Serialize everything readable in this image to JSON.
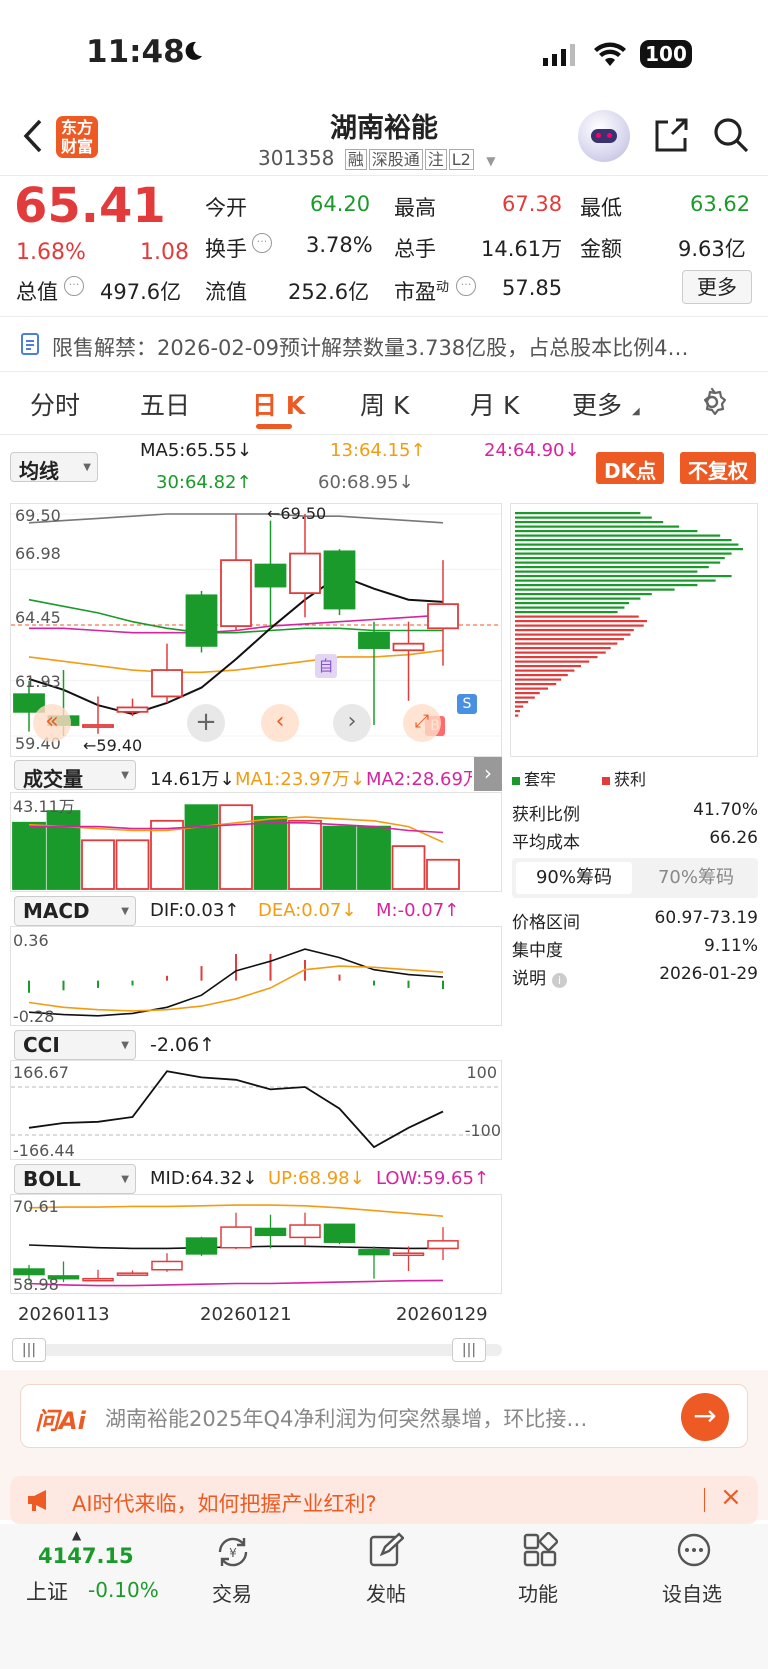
{
  "status_bar": {
    "time": "11:48",
    "battery": "100"
  },
  "header": {
    "logo": "东方财富",
    "title": "湖南裕能",
    "code": "301358",
    "tags": [
      "融",
      "深股通",
      "注",
      "L2"
    ]
  },
  "quote": {
    "price": "65.41",
    "change_pct": "1.68%",
    "change": "1.08",
    "open_label": "今开",
    "open": "64.20",
    "high_label": "最高",
    "high": "67.38",
    "low_label": "最低",
    "low": "63.62",
    "turnover_label": "换手",
    "turnover": "3.78%",
    "volume_label": "总手",
    "volume": "14.61万",
    "amount_label": "金额",
    "amount": "9.63亿",
    "mktcap_label": "总值",
    "mktcap": "497.6亿",
    "float_label": "流值",
    "float": "252.6亿",
    "pe_label": "市盈",
    "pe_sup": "动",
    "pe": "57.85",
    "more_button": "更多"
  },
  "notice": "限售解禁：2026-02-09预计解禁数量3.738亿股，占总股本比例4…",
  "tabs": [
    "分时",
    "五日",
    "日 K",
    "周 K",
    "月 K",
    "更多"
  ],
  "active_tab": 2,
  "ma_bar": {
    "select": "均线",
    "ma5": "MA5:65.55",
    "ma13": "13:64.15",
    "ma24": "24:64.90",
    "ma30": "30:64.82",
    "ma60": "60:68.95",
    "dk_button": "DK点",
    "fq_button": "不复权"
  },
  "kchart": {
    "ymax": "69.50",
    "y2": "66.98",
    "y3": "64.45",
    "y4": "61.93",
    "ymin": "59.40",
    "hi_mark": "69.50",
    "lo_mark": "59.40",
    "self_mark": "自",
    "s_mark": "S",
    "b_mark": "B"
  },
  "chips": {
    "legend_locked": "套牢",
    "legend_profit": "获利",
    "profit_ratio_label": "获利比例",
    "profit_ratio": "41.70%",
    "avg_cost_label": "平均成本",
    "avg_cost": "66.26",
    "tab_90": "90%筹码",
    "tab_70": "70%筹码",
    "range_label": "价格区间",
    "range": "60.97-73.19",
    "concentration_label": "集中度",
    "concentration": "9.11%",
    "note_label": "说明",
    "note": "2026-01-29"
  },
  "volume": {
    "select": "成交量",
    "value": "14.61万",
    "ma1": "MA1:23.97万",
    "ma2": "MA2:28.69万",
    "ymax": "43.11万"
  },
  "macd": {
    "select": "MACD",
    "dif": "DIF:0.03",
    "dea": "DEA:0.07",
    "m": "M:-0.07",
    "ymax": "0.36",
    "ymin": "-0.28"
  },
  "cci": {
    "select": "CCI",
    "value": "-2.06",
    "ymax": "166.67",
    "ymin": "-166.44",
    "r100": "100",
    "rm100": "-100"
  },
  "boll": {
    "select": "BOLL",
    "mid": "MID:64.32",
    "up": "UP:68.98",
    "low": "LOW:59.65",
    "ymax": "70.61",
    "ymin": "58.98"
  },
  "dates": [
    "20260113",
    "20260121",
    "20260129"
  ],
  "ai": {
    "placeholder": "湖南裕能2025年Q4净利润为何突然暴增，环比接…",
    "logo": "问Ai"
  },
  "banner": "AI时代来临，如何把握产业红利?",
  "nav": {
    "index_value": "4147.15",
    "index_name": "上证",
    "index_change": "-0.10%",
    "items": [
      "交易",
      "发帖",
      "功能",
      "设自选"
    ]
  },
  "colors": {
    "up": "#e23b3b",
    "down": "#1a9a2a",
    "accent": "#ee5a24"
  },
  "chart_data": {
    "type": "candlestick",
    "candles": [
      {
        "open": 61.3,
        "close": 60.5,
        "high": 61.9,
        "low": 59.6
      },
      {
        "open": 60.3,
        "close": 59.9,
        "high": 62.4,
        "low": 59.4
      },
      {
        "open": 59.9,
        "close": 59.9,
        "high": 61.2,
        "low": 59.5
      },
      {
        "open": 60.5,
        "close": 60.7,
        "high": 61.1,
        "low": 60.3
      },
      {
        "open": 61.2,
        "close": 62.4,
        "high": 63.6,
        "low": 60.9
      },
      {
        "open": 65.8,
        "close": 63.5,
        "high": 66.0,
        "low": 63.2
      },
      {
        "open": 64.4,
        "close": 67.4,
        "high": 69.5,
        "low": 64.2
      },
      {
        "open": 67.2,
        "close": 66.2,
        "high": 69.2,
        "low": 64.3
      },
      {
        "open": 65.9,
        "close": 67.7,
        "high": 69.5,
        "low": 64.8
      },
      {
        "open": 67.8,
        "close": 65.2,
        "high": 67.9,
        "low": 64.9
      },
      {
        "open": 64.1,
        "close": 63.4,
        "high": 64.6,
        "low": 59.9
      },
      {
        "open": 63.3,
        "close": 63.6,
        "high": 64.6,
        "low": 61.0
      },
      {
        "open": 64.3,
        "close": 65.4,
        "high": 67.4,
        "low": 62.6
      }
    ],
    "ma5": [
      62.0,
      61.5,
      60.8,
      60.4,
      60.9,
      61.6,
      62.9,
      64.3,
      65.6,
      66.7,
      66.1,
      65.6,
      65.5
    ],
    "ma13": [
      65.6,
      65.3,
      65.0,
      64.6,
      64.3,
      64.1,
      64.1,
      64.2,
      64.3,
      64.3,
      64.2,
      64.2,
      64.2
    ],
    "ma24": [
      64.3,
      64.3,
      64.2,
      64.1,
      64.1,
      64.1,
      64.2,
      64.4,
      64.5,
      64.6,
      64.7,
      64.8,
      64.9
    ],
    "ma30": [
      63.0,
      62.8,
      62.6,
      62.4,
      62.3,
      62.3,
      62.4,
      62.6,
      62.8,
      63.0,
      63.0,
      63.1,
      63.3
    ],
    "ma60": [
      69.1,
      69.2,
      69.3,
      69.4,
      69.5,
      69.5,
      69.5,
      69.5,
      69.4,
      69.4,
      69.3,
      69.2,
      69.1
    ],
    "volume": [
      34,
      40,
      25,
      25,
      35,
      43,
      43,
      37,
      35,
      32,
      32,
      22,
      15
    ],
    "vol_ma1": [
      33,
      32,
      31,
      30,
      30,
      32,
      34,
      36,
      37,
      36,
      35,
      32,
      24
    ],
    "vol_ma2": [
      32,
      32,
      32,
      31,
      31,
      32,
      33,
      34,
      34,
      33,
      32,
      30,
      29
    ],
    "macd_dif": [
      -0.26,
      -0.28,
      -0.29,
      -0.27,
      -0.22,
      -0.12,
      0.08,
      0.16,
      0.26,
      0.19,
      0.09,
      0.05,
      0.03
    ],
    "macd_dea": [
      -0.18,
      -0.22,
      -0.24,
      -0.25,
      -0.24,
      -0.21,
      -0.15,
      -0.06,
      0.09,
      0.12,
      0.11,
      0.09,
      0.07
    ],
    "macd_hist": [
      -0.1,
      -0.08,
      -0.06,
      -0.04,
      0.04,
      0.12,
      0.22,
      0.22,
      0.17,
      0.05,
      -0.04,
      -0.06,
      -0.07
    ],
    "cci": [
      -70,
      -50,
      -45,
      -25,
      166,
      140,
      130,
      90,
      100,
      10,
      -150,
      -70,
      -2.06
    ],
    "boll_up": [
      70.2,
      70.3,
      70.3,
      70.4,
      70.4,
      70.5,
      70.6,
      70.6,
      70.5,
      70.2,
      69.8,
      69.4,
      68.98
    ],
    "boll_mid": [
      64.8,
      64.6,
      64.4,
      64.3,
      64.3,
      64.4,
      64.5,
      64.6,
      64.6,
      64.5,
      64.4,
      64.3,
      64.32
    ],
    "boll_low": [
      59.2,
      59.0,
      58.9,
      58.9,
      59.0,
      59.1,
      59.2,
      59.2,
      59.3,
      59.4,
      59.5,
      59.6,
      59.65
    ],
    "chips_locked": [
      0.55,
      0.6,
      0.65,
      0.72,
      0.8,
      0.9,
      0.95,
      0.98,
      1.0,
      0.95,
      0.92,
      0.9,
      0.85,
      0.8,
      0.95,
      0.88,
      0.8,
      0.7,
      0.6,
      0.55,
      0.5,
      0.48,
      0.45
    ],
    "chips_profit": [
      0.75,
      0.8,
      0.78,
      0.72,
      0.7,
      0.66,
      0.62,
      0.58,
      0.55,
      0.5,
      0.45,
      0.4,
      0.36,
      0.32,
      0.28,
      0.25,
      0.2,
      0.15,
      0.12,
      0.08,
      0.05,
      0.03,
      0.02
    ]
  }
}
